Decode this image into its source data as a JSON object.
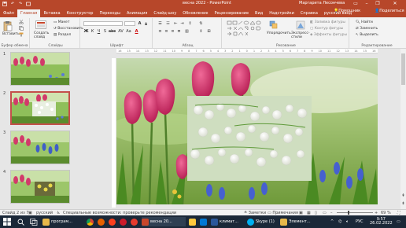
{
  "title_bar": {
    "document_title": "весна 2022  -  PowerPoint",
    "user_name": "Маргарита Лесончева",
    "icons": [
      "save-icon",
      "undo-icon",
      "redo-icon",
      "start-from-beginning-icon"
    ]
  },
  "tabs": [
    {
      "label": "Файл"
    },
    {
      "label": "Главная",
      "active": true
    },
    {
      "label": "Вставка"
    },
    {
      "label": "Конструктор"
    },
    {
      "label": "Переходы"
    },
    {
      "label": "Анимация"
    },
    {
      "label": "Слайд-шоу"
    },
    {
      "label": "Обновление"
    },
    {
      "label": "Рецензирование"
    },
    {
      "label": "Вид"
    },
    {
      "label": "Надстройки"
    },
    {
      "label": "Справка"
    },
    {
      "label": "русский ввод"
    }
  ],
  "tell_me": "Помощник",
  "share": "Поделиться",
  "ribbon": {
    "clipboard": {
      "paste": "Вставить",
      "label": "Буфер обмена"
    },
    "slides": {
      "new_slide": "Создать слайд",
      "layout": "Макет",
      "reset": "Восстановить",
      "section": "Раздел",
      "label": "Слайды"
    },
    "font": {
      "label": "Шрифт"
    },
    "paragraph": {
      "label": "Абзац"
    },
    "drawing": {
      "arrange": "Упорядочить",
      "quick_styles": "Экспресс-стили",
      "shape_fill": "Заливка фигуры",
      "shape_outline": "Контур фигуры",
      "shape_effects": "Эффекты фигуры",
      "label": "Рисование"
    },
    "editing": {
      "find": "Найти",
      "replace": "Заменить",
      "select": "Выделить",
      "label": "Редактирование"
    }
  },
  "thumbnails": [
    {
      "number": "1"
    },
    {
      "number": "2",
      "selected": true
    },
    {
      "number": "3"
    },
    {
      "number": "4"
    }
  ],
  "ruler_labels": [
    "16",
    "15",
    "14",
    "13",
    "12",
    "11",
    "10",
    "9",
    "8",
    "7",
    "6",
    "5",
    "4",
    "3",
    "2",
    "1",
    "0",
    "1",
    "2",
    "3",
    "4",
    "5",
    "6",
    "7",
    "8",
    "9",
    "10",
    "11",
    "12",
    "13",
    "14",
    "15",
    "16"
  ],
  "status_bar": {
    "slide_info": "Слайд 2 из 7",
    "language": "русский",
    "accessibility": "Специальные возможности: проверьте рекомендации",
    "notes": "Заметки",
    "comments": "Примечания",
    "zoom": "69 %",
    "zoom_value": 69
  },
  "taskbar": {
    "items": [
      {
        "label": "програм...",
        "icon": "folder-icon",
        "color": "#e8b84a"
      },
      {
        "label": "весна 20...",
        "icon": "powerpoint-icon",
        "color": "#c8462b"
      },
      {
        "label": "климат...",
        "icon": "word-icon",
        "color": "#2b579a"
      },
      {
        "label": "Skype (1)",
        "icon": "skype-icon",
        "color": "#00aff0"
      },
      {
        "label": "Элемент...",
        "icon": "explorer-icon",
        "color": "#e8b84a"
      }
    ],
    "language": "РУС",
    "time": "9:57",
    "date": "26.02.2022"
  },
  "colors": {
    "accent": "#b7472a",
    "ribbon_bg": "#f3f3f3",
    "taskbar_bg": "#1b2838",
    "selected_thumb_border": "#c4504b"
  }
}
